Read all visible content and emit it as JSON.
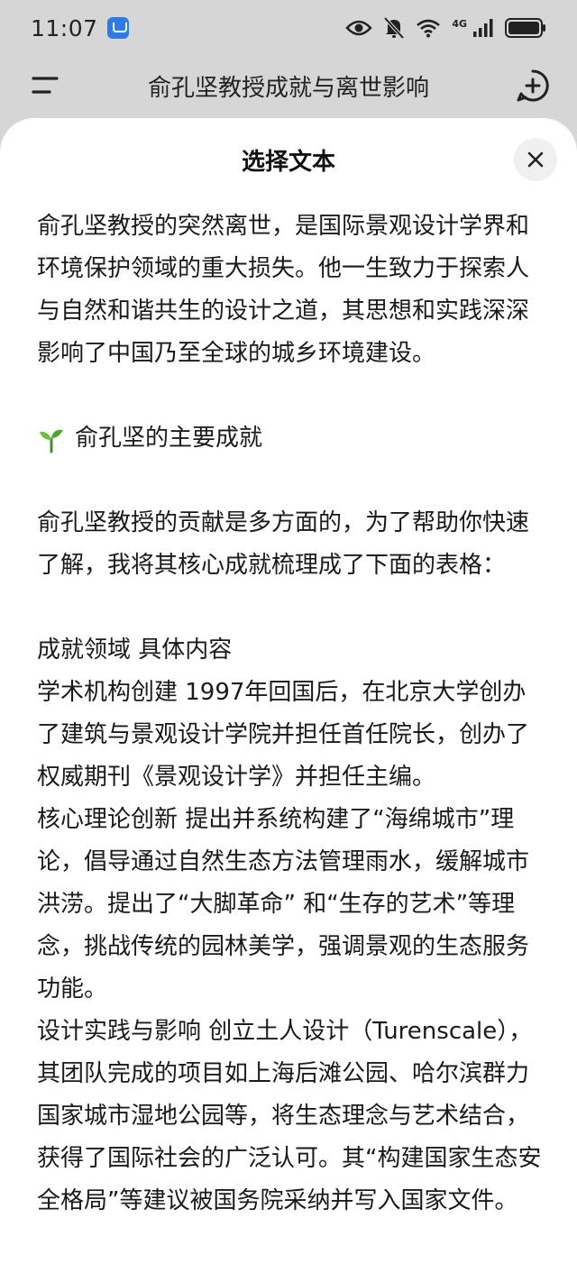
{
  "status_bar": {
    "time": "11:07",
    "network_label": "4G"
  },
  "header": {
    "title": "俞孔坚教授成就与离世影响"
  },
  "sheet": {
    "title": "选择文本",
    "paragraphs": {
      "intro": "俞孔坚教授的突然离世，是国际景观设计学界和环境保护领域的重大损失。他一生致力于探索人与自然和谐共生的设计之道，其思想和实践深深影响了中国乃至全球的城乡环境建设。",
      "section_heading": "俞孔坚的主要成就",
      "lead": "俞孔坚教授的贡献是多方面的，为了帮助你快速了解，我将其核心成就梳理成了下面的表格：",
      "table_header": "成就领域 具体内容",
      "row1": "学术机构创建 1997年回国后，在北京大学创办了建筑与景观设计学院并担任首任院长，创办了权威期刊《景观设计学》并担任主编。",
      "row2": "核心理论创新 提出并系统构建了“海绵城市”理论，倡导通过自然生态方法管理雨水，缓解城市洪涝。提出了“大脚革命” 和“生存的艺术”等理念，挑战传统的园林美学，强调景观的生态服务功能。",
      "row3": "设计实践与影响 创立土人设计（Turenscale），其团队完成的项目如上海后滩公园、哈尔滨群力国家城市湿地公园等，将生态理念与艺术结合，获得了国际社会的广泛认可。其“构建国家生态安全格局”等建议被国务院采纳并写入国家文件。"
    }
  },
  "icons": {
    "menu": "menu-icon",
    "new_chat": "add-circle-icon",
    "close": "close-icon",
    "sprout": "seedling-emoji"
  },
  "colors": {
    "backdrop": "#d6d6d6",
    "sheet": "#ffffff",
    "text": "#1a1a1a"
  }
}
